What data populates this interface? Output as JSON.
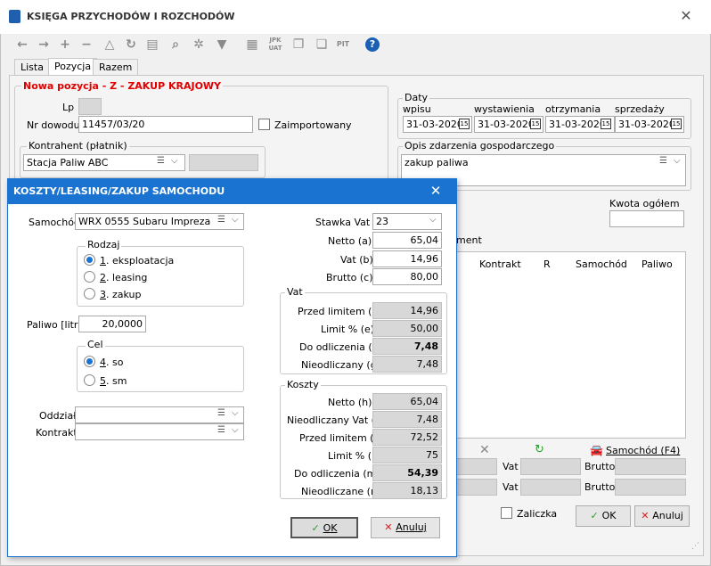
{
  "window": {
    "title": "KSIĘGA PRZYCHODÓW I ROZCHODÓW"
  },
  "toolbar": {
    "icons": [
      "arrow-left",
      "arrow-right",
      "plus",
      "minus",
      "triangle",
      "refresh",
      "print",
      "search",
      "settings",
      "filter",
      "barcode",
      "jpk",
      "copy",
      "copy-alt",
      "pit",
      "help"
    ],
    "jpk_label": "JPK\nUAT",
    "pit_label": "PIT"
  },
  "tabs": [
    "Lista",
    "Pozycja",
    "Razem"
  ],
  "form": {
    "header": "Nowa pozycja - Z - ZAKUP KRAJOWY",
    "lp_label": "Lp",
    "lp_value": "",
    "nr_label": "Nr dowodu",
    "nr_value": "11457/03/20",
    "zaimport_label": "Zaimportowany",
    "kontrahent_label": "Kontrahent (płatnik)",
    "kontrahent_value": "Stacja Paliw ABC",
    "daty_label": "Daty",
    "daty": [
      {
        "label": "wpisu",
        "value": "31-03-2020"
      },
      {
        "label": "wystawienia",
        "value": "31-03-2020"
      },
      {
        "label": "otrzymania",
        "value": "31-03-2020"
      },
      {
        "label": "sprzedaży",
        "value": "31-03-2020"
      }
    ],
    "cal_icon": "15",
    "opis_label": "Opis zdarzenia gospodarczego",
    "opis_value": "zakup paliwa",
    "kwota_label": "Kwota ogółem",
    "kwota_value": "",
    "element_label": "ment",
    "grid_cols": [
      "Kontrakt",
      "R",
      "Samochód",
      "Paliwo"
    ],
    "samochod_btn": "Samochód (F4)",
    "vat_label": "Vat",
    "brutto_label": "Brutto",
    "zaliczka_label": "Zaliczka",
    "ok": "OK",
    "anuluj": "Anuluj"
  },
  "modal": {
    "title": "KOSZTY/LEASING/ZAKUP SAMOCHODU",
    "samochod_label": "Samochód",
    "samochod_value": "WRX 0555 Subaru Impreza",
    "rodzaj_label": "Rodzaj",
    "rodzaj": [
      {
        "num": "1",
        "text": ". eksploatacja",
        "on": true
      },
      {
        "num": "2",
        "text": ". leasing",
        "on": false
      },
      {
        "num": "3",
        "text": ". zakup",
        "on": false
      }
    ],
    "paliwo_label": "Paliwo [litr]",
    "paliwo_value": "20,0000",
    "cel_label": "Cel",
    "cel": [
      {
        "num": "4",
        "text": ". so",
        "on": true
      },
      {
        "num": "5",
        "text": ". sm",
        "on": false
      }
    ],
    "oddzial_label": "Oddział",
    "kontrakt_label": "Kontrakt",
    "stawka_label": "Stawka Vat",
    "stawka_value": "23",
    "netto_label": "Netto (a)",
    "netto_value": "65,04",
    "vat_label": "Vat (b)",
    "vat_value": "14,96",
    "brutto_label": "Brutto (c)",
    "brutto_value": "80,00",
    "vatgrp_label": "Vat",
    "vatgrp": [
      {
        "label": "Przed limitem (d)",
        "value": "14,96",
        "bold": false
      },
      {
        "label": "Limit % (e)",
        "value": "50,00",
        "bold": false
      },
      {
        "label": "Do odliczenia (f)",
        "value": "7,48",
        "bold": true
      },
      {
        "label": "Nieodliczany (g)",
        "value": "7,48",
        "bold": false
      }
    ],
    "koszty_label": "Koszty",
    "koszty": [
      {
        "label": "Netto (h)",
        "value": "65,04",
        "bold": false
      },
      {
        "label": "Nieodliczany Vat (i)",
        "value": "7,48",
        "bold": false
      },
      {
        "label": "Przed limitem (j)",
        "value": "72,52",
        "bold": false
      },
      {
        "label": "Limit % (l)",
        "value": "75",
        "bold": false
      },
      {
        "label": "Do odliczenia (m)",
        "value": "54,39",
        "bold": true
      },
      {
        "label": "Nieodliczane (n)",
        "value": "18,13",
        "bold": false
      }
    ],
    "ok": "OK",
    "anuluj": "Anuluj"
  },
  "colors": {
    "accent": "#1a73d0",
    "header_red": "#e00000"
  }
}
